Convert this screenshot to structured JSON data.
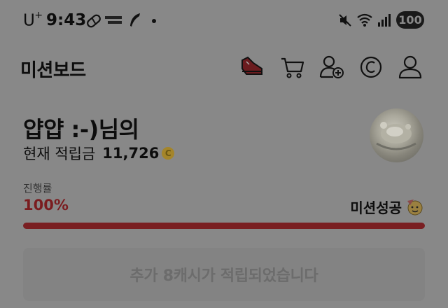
{
  "status_bar": {
    "carrier": "U",
    "carrier_sup": "+",
    "time": "9:43",
    "battery": "100",
    "icons": [
      "pill-icon",
      "cashfeed-icon",
      "feather-icon",
      "dot-icon",
      "mute-icon",
      "wifi-icon",
      "signal-icon",
      "battery-icon"
    ]
  },
  "header": {
    "title": "미션보드",
    "icons": [
      "sneaker-icon",
      "cart-icon",
      "add-friend-icon",
      "cash-icon",
      "profile-icon"
    ]
  },
  "user": {
    "greeting": "얍얍 :-)님의",
    "balance_label": "현재 적립금",
    "balance_value": "11,726",
    "coin_symbol": "C"
  },
  "progress": {
    "label": "진행률",
    "percent_text": "100%",
    "value": 1.0,
    "status": "미션성공"
  },
  "reward_button": {
    "label": "추가 8캐시가 적립되었습니다"
  },
  "colors": {
    "accent": "#7a1f22",
    "overlay": "#888888"
  }
}
